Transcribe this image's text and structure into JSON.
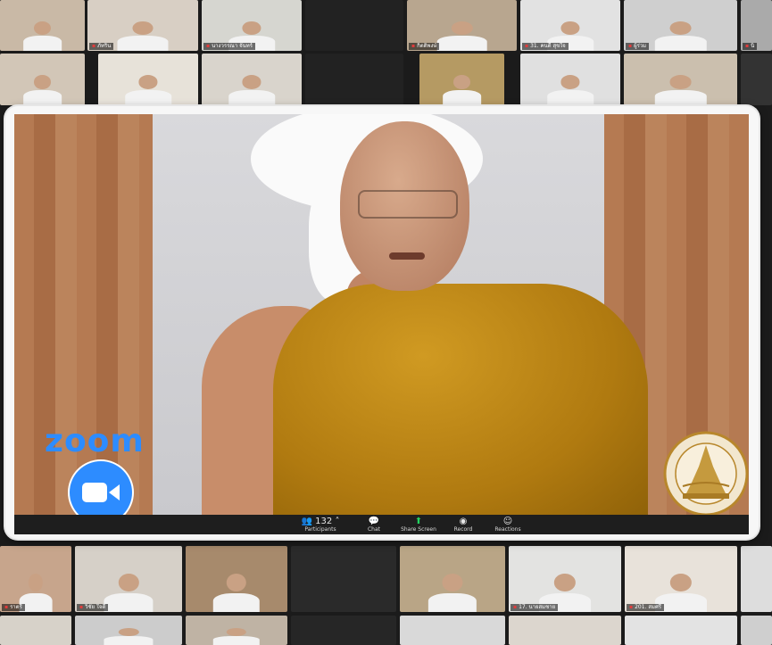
{
  "app": {
    "logo_text": "zoom",
    "camera_icon": "video-camera-icon"
  },
  "speaker": {
    "description_icon": "speaker-video"
  },
  "toolbar": {
    "participants_count": "132",
    "participants_label": "Participants",
    "chat_label": "Chat",
    "share_label": "Share Screen",
    "record_label": "Record",
    "reactions_label": "Reactions"
  },
  "colors": {
    "zoom_blue": "#2d8cff",
    "robe": "#c08a1a",
    "share_green": "#23d160",
    "background": "#1b1b1b"
  },
  "gallery": {
    "top_row": [
      {
        "name": "",
        "bg": "#c9b9a6"
      },
      {
        "name": "ภัทริน",
        "bg": "#d8cfc4"
      },
      {
        "name": "นางวรรณา จันทร์",
        "bg": "#d6d6d0"
      },
      {
        "name": "",
        "bg": "#222"
      },
      {
        "name": "กิตติพงษ์",
        "bg": "#b8a68f"
      },
      {
        "name": "31. คนดี สุขใจ",
        "bg": "#e2e2e2"
      },
      {
        "name": "ผู้ร่วม",
        "bg": "#cfcfcf"
      },
      {
        "name": "นิ",
        "bg": "#aaa"
      }
    ],
    "second_row": [
      {
        "name": "",
        "bg": "#d2c6b7"
      },
      {
        "name": "",
        "bg": "#e7e2d9"
      },
      {
        "name": "",
        "bg": "#d9d4cc"
      },
      {
        "name": "",
        "bg": "#222"
      },
      {
        "name": "",
        "bg": "#b59a63"
      },
      {
        "name": "",
        "bg": "#e0e0e0"
      },
      {
        "name": "",
        "bg": "#cbbfae"
      },
      {
        "name": "",
        "bg": "#333"
      }
    ],
    "bottom_row": [
      {
        "name": "ราตรี",
        "bg": "#c7a58c"
      },
      {
        "name": "วิชัย ใจดี",
        "bg": "#d6d0c8"
      },
      {
        "name": "",
        "bg": "#a78a6c"
      },
      {
        "name": "",
        "bg": "#2a2a2a"
      },
      {
        "name": "",
        "bg": "#b9a586"
      },
      {
        "name": "17. นายสมชาย",
        "bg": "#e3e3e1"
      },
      {
        "name": "201. สมศรี",
        "bg": "#e8e2da"
      },
      {
        "name": "",
        "bg": "#ddd"
      }
    ],
    "last_row": [
      {
        "name": "",
        "bg": "#d7d2c9"
      },
      {
        "name": "",
        "bg": "#ccc"
      },
      {
        "name": "",
        "bg": "#bfb3a4"
      },
      {
        "name": "",
        "bg": "#262626"
      },
      {
        "name": "",
        "bg": "#d9d9d9"
      },
      {
        "name": "",
        "bg": "#dcd6ce"
      },
      {
        "name": "",
        "bg": "#e3e3e3"
      },
      {
        "name": "",
        "bg": "#cfcfcf"
      }
    ]
  }
}
